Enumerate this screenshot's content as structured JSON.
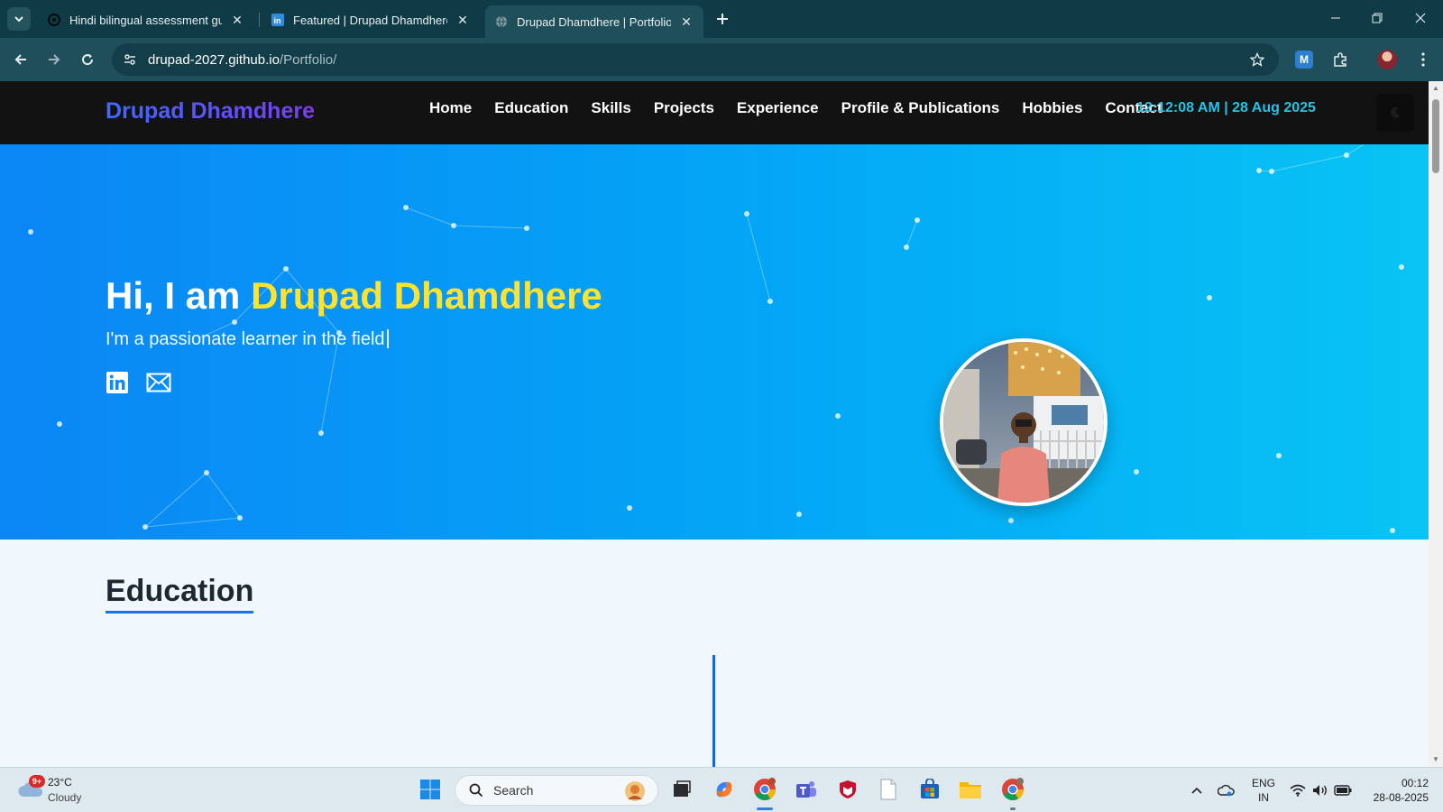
{
  "browser": {
    "tabs": [
      {
        "title": "Hindi bilingual assessment guid",
        "favicon": "chatgpt-icon",
        "active": false
      },
      {
        "title": "Featured | Drupad Dhamdhere |",
        "favicon": "linkedin-icon",
        "active": false
      },
      {
        "title": "Drupad Dhamdhere | Portfolio",
        "favicon": "globe-icon",
        "active": true
      }
    ],
    "url_host": "drupad-2027.github.io",
    "url_path": "/Portfolio/"
  },
  "site": {
    "brand": "Drupad Dhamdhere",
    "nav": [
      "Home",
      "Education",
      "Skills",
      "Projects",
      "Experience",
      "Profile & Publications",
      "Hobbies",
      "Contact"
    ],
    "clock": "12:12:08 AM | 28 Aug 2025",
    "theme_toggle_icon": "moon-icon"
  },
  "hero": {
    "greeting": "Hi, I am ",
    "name": "Drupad Dhamdhere",
    "subtitle": "I'm a passionate learner in the field",
    "socials": [
      "linkedin-icon",
      "mail-icon"
    ]
  },
  "education": {
    "title": "Education"
  },
  "taskbar": {
    "weather_badge": "9+",
    "weather_temp": "23°C",
    "weather_desc": "Cloudy",
    "search_label": "Search",
    "lang_line1": "ENG",
    "lang_line2": "IN",
    "time": "00:12",
    "date": "28-08-2025"
  },
  "colors": {
    "tab_strip": "#0f3b47",
    "toolbar": "#1f4f5b",
    "site_header": "#121212",
    "hero_start": "#0b86f5",
    "hero_end": "#08c4f4",
    "name_highlight": "#ffe32e",
    "clock": "#22c3e6",
    "accent": "#1a73e8"
  }
}
